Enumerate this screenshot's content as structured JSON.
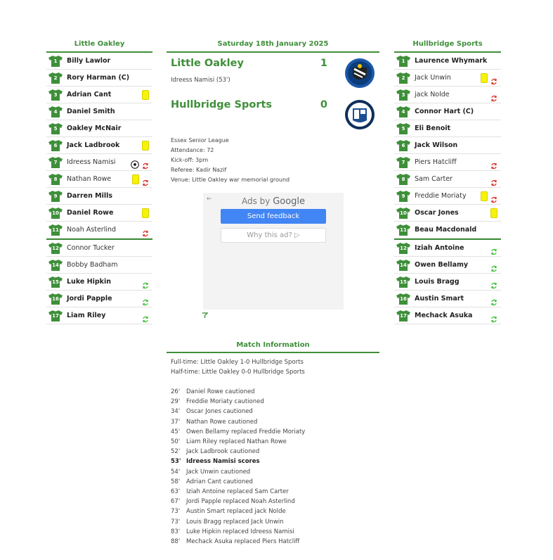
{
  "home_team": {
    "name": "Little Oakley",
    "players": [
      {
        "num": "1",
        "name": "Billy Lawlor",
        "bold": true,
        "icons": []
      },
      {
        "num": "2",
        "name": "Rory Harman (C)",
        "bold": true,
        "icons": []
      },
      {
        "num": "3",
        "name": "Adrian Cant",
        "bold": true,
        "icons": [
          "yellow-card"
        ]
      },
      {
        "num": "4",
        "name": "Daniel Smith",
        "bold": true,
        "icons": []
      },
      {
        "num": "5",
        "name": "Oakley McNair",
        "bold": true,
        "icons": []
      },
      {
        "num": "6",
        "name": "Jack Ladbrook",
        "bold": true,
        "icons": [
          "yellow-card"
        ]
      },
      {
        "num": "7",
        "name": "Idreess Namisi",
        "bold": false,
        "icons": [
          "ball",
          "sub-off"
        ]
      },
      {
        "num": "8",
        "name": "Nathan Rowe",
        "bold": false,
        "icons": [
          "yellow-card",
          "sub-off"
        ]
      },
      {
        "num": "9",
        "name": "Darren Mills",
        "bold": true,
        "icons": []
      },
      {
        "num": "10",
        "name": "Daniel Rowe",
        "bold": true,
        "icons": [
          "yellow-card"
        ]
      },
      {
        "num": "11",
        "name": "Noah Asterlind",
        "bold": false,
        "icons": [
          "sub-off"
        ]
      },
      {
        "num": "12",
        "name": "Connor Tucker",
        "bold": false,
        "icons": []
      },
      {
        "num": "14",
        "name": "Bobby Badham",
        "bold": false,
        "icons": []
      },
      {
        "num": "15",
        "name": "Luke Hipkin",
        "bold": true,
        "icons": [
          "sub-on"
        ]
      },
      {
        "num": "16",
        "name": "Jordi Papple",
        "bold": true,
        "icons": [
          "sub-on"
        ]
      },
      {
        "num": "17",
        "name": "Liam Riley",
        "bold": true,
        "icons": [
          "sub-on"
        ]
      }
    ]
  },
  "away_team": {
    "name": "Hullbridge Sports",
    "players": [
      {
        "num": "1",
        "name": "Laurence Whymark",
        "bold": true,
        "icons": []
      },
      {
        "num": "2",
        "name": "Jack Unwin",
        "bold": false,
        "icons": [
          "yellow-card",
          "sub-off"
        ]
      },
      {
        "num": "3",
        "name": "jack Nolde",
        "bold": false,
        "icons": [
          "sub-off"
        ]
      },
      {
        "num": "4",
        "name": "Connor Hart (C)",
        "bold": true,
        "icons": []
      },
      {
        "num": "5",
        "name": "Eli Benoit",
        "bold": true,
        "icons": []
      },
      {
        "num": "6",
        "name": "Jack Wilson",
        "bold": true,
        "icons": []
      },
      {
        "num": "7",
        "name": "Piers Hatcliff",
        "bold": false,
        "icons": [
          "sub-off"
        ]
      },
      {
        "num": "8",
        "name": "Sam Carter",
        "bold": false,
        "icons": [
          "sub-off"
        ]
      },
      {
        "num": "9",
        "name": "Freddie Moriaty",
        "bold": false,
        "icons": [
          "yellow-card",
          "sub-off"
        ]
      },
      {
        "num": "10",
        "name": "Oscar Jones",
        "bold": true,
        "icons": [
          "yellow-card"
        ]
      },
      {
        "num": "11",
        "name": "Beau Macdonald",
        "bold": true,
        "icons": []
      },
      {
        "num": "12",
        "name": "Iziah Antoine",
        "bold": true,
        "icons": [
          "sub-on"
        ]
      },
      {
        "num": "14",
        "name": "Owen Bellamy",
        "bold": true,
        "icons": [
          "sub-on"
        ]
      },
      {
        "num": "15",
        "name": "Louis Bragg",
        "bold": true,
        "icons": [
          "sub-on"
        ]
      },
      {
        "num": "16",
        "name": "Austin Smart",
        "bold": true,
        "icons": [
          "sub-on"
        ]
      },
      {
        "num": "17",
        "name": "Mechack Asuka",
        "bold": true,
        "icons": [
          "sub-on"
        ]
      }
    ]
  },
  "match": {
    "date": "Saturday 18th January 2025",
    "home_name": "Little Oakley",
    "home_score": "1",
    "home_scorer": "Idreess Namisi (53')",
    "away_name": "Hullbridge Sports",
    "away_score": "0",
    "competition": "Essex Senior League",
    "attendance": "Attendance: 72",
    "kickoff": "Kick-off: 3pm",
    "referee": "Referee: Kadir Nazif",
    "venue": "Venue: Little Oakley war memorial ground"
  },
  "ad": {
    "title_prefix": "Ads by",
    "title_brand": "Google",
    "send_feedback": "Send feedback",
    "why_ad": "Why this ad? ▷"
  },
  "match_info": {
    "heading": "Match Information",
    "full_time": "Full-time: Little Oakley 1-0 Hullbridge Sports",
    "half_time": "Half-time: Little Oakley 0-0 Hullbridge Sports",
    "events": [
      {
        "min": "26'",
        "text": "Daniel Rowe cautioned",
        "goal": false
      },
      {
        "min": "29'",
        "text": "Freddie Moriaty cautioned",
        "goal": false
      },
      {
        "min": "34'",
        "text": "Oscar Jones cautioned",
        "goal": false
      },
      {
        "min": "37'",
        "text": "Nathan Rowe cautioned",
        "goal": false
      },
      {
        "min": "45'",
        "text": "Owen Bellamy replaced Freddie Moriaty",
        "goal": false
      },
      {
        "min": "50'",
        "text": "Liam Riley replaced Nathan Rowe",
        "goal": false
      },
      {
        "min": "52'",
        "text": "Jack Ladbrook cautioned",
        "goal": false
      },
      {
        "min": "53'",
        "text": "Idreess Namisi scores",
        "goal": true
      },
      {
        "min": "54'",
        "text": "Jack Unwin cautioned",
        "goal": false
      },
      {
        "min": "58'",
        "text": "Adrian Cant cautioned",
        "goal": false
      },
      {
        "min": "63'",
        "text": "Iziah Antoine replaced Sam Carter",
        "goal": false
      },
      {
        "min": "67'",
        "text": "Jordi Papple replaced Noah Asterlind",
        "goal": false
      },
      {
        "min": "73'",
        "text": "Austin Smart replaced jack Nolde",
        "goal": false
      },
      {
        "min": "73'",
        "text": "Louis Bragg replaced Jack Unwin",
        "goal": false
      },
      {
        "min": "83'",
        "text": "Luke Hipkin replaced Idreess Namisi",
        "goal": false
      },
      {
        "min": "88'",
        "text": "Mechack Asuka replaced Piers Hatcliff",
        "goal": false
      }
    ]
  },
  "colors": {
    "accent": "#3f8f3a",
    "yellow_card": "#f7f20a",
    "sub_off": "#d9342b",
    "sub_on": "#3fbf3a"
  }
}
